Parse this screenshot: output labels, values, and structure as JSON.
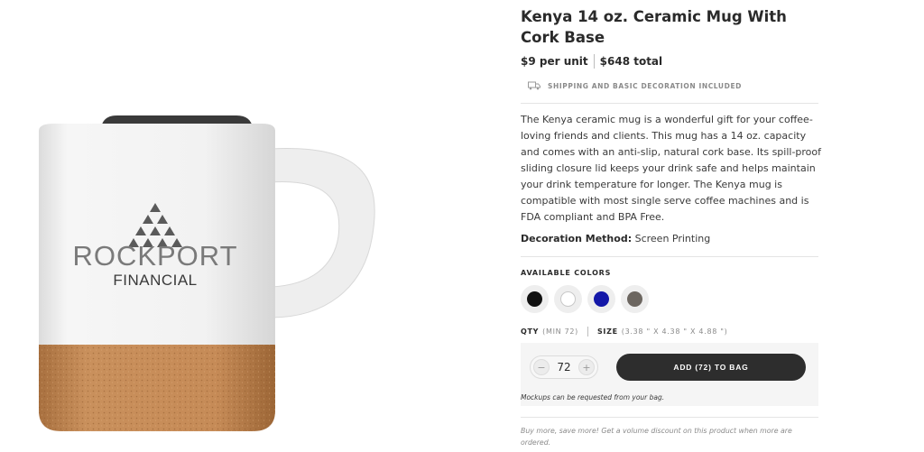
{
  "product": {
    "title": "Kenya 14 oz. Ceramic Mug With Cork Base",
    "price_unit": "$9 per unit",
    "price_total": "$648 total",
    "shipping_note": "SHIPPING AND BASIC DECORATION INCLUDED",
    "description": "The Kenya ceramic mug is a wonderful gift for your coffee-loving friends and clients. This mug has a 14 oz. capacity and comes with an anti-slip, natural cork base. Its spill-proof sliding closure lid keeps your drink safe and helps maintain your drink temperature for longer. The Kenya mug is compatible with most single serve coffee machines and is FDA compliant and BPA Free.",
    "decoration_label": "Decoration Method:",
    "decoration_value": "Screen Printing"
  },
  "image": {
    "logo_line1": "ROCKPORT",
    "logo_line2": "FINANCIAL"
  },
  "colors": {
    "heading": "AVAILABLE COLORS",
    "options": [
      {
        "name": "black-swatch",
        "hex": "#111111"
      },
      {
        "name": "white-swatch",
        "hex": "#ffffff"
      },
      {
        "name": "blue-swatch",
        "hex": "#1418a8"
      },
      {
        "name": "gray-swatch",
        "hex": "#6c6660"
      }
    ]
  },
  "order": {
    "qty_label": "QTY",
    "qty_min": "(MIN 72)",
    "size_label": "SIZE",
    "size_value": "(3.38 \" X 4.38 \" X 4.88 \")",
    "quantity": "72",
    "minus": "−",
    "plus": "+",
    "add_button": "ADD (72) TO BAG",
    "mockup_note": "Mockups can be requested from your bag.",
    "volume_note": "Buy more, save more! Get a volume discount on this product when more are ordered."
  },
  "theme": {
    "button_bg": "#2d2d2d",
    "cork": "#c48a56",
    "mug_white": "#f4f4f4"
  }
}
